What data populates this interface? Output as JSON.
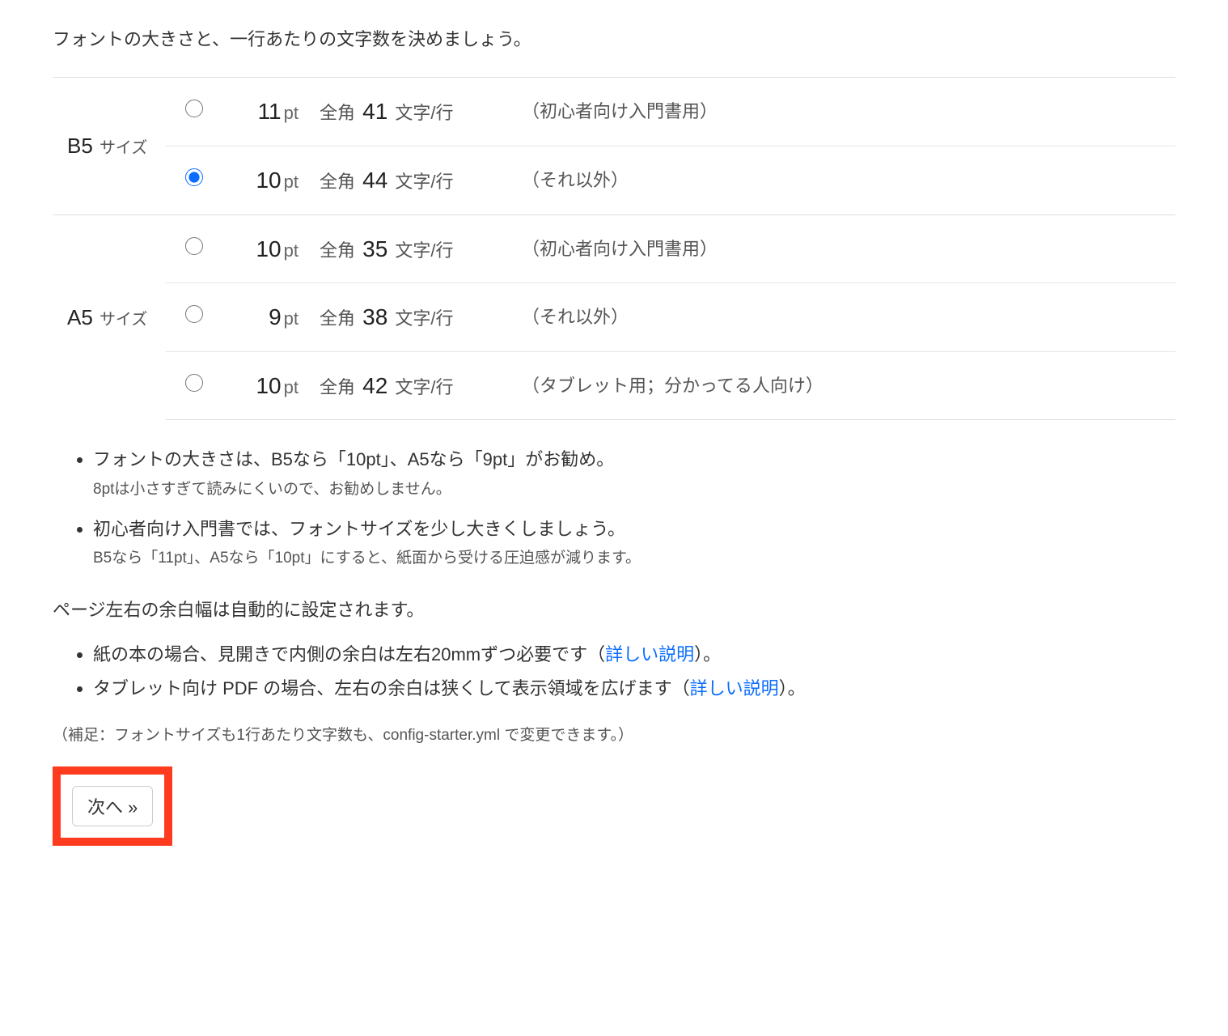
{
  "intro": "フォントの大きさと、一行あたりの文字数を決めましょう。",
  "sizes": {
    "b5": {
      "label_big": "B5",
      "label_suffix": "サイズ"
    },
    "a5": {
      "label_big": "A5",
      "label_suffix": "サイズ"
    }
  },
  "chars_prefix": "全角",
  "chars_suffix": "文字/行",
  "pt_unit": "pt",
  "rows": [
    {
      "id": "b5-11",
      "pt": "11",
      "chars": "41",
      "note": "（初心者向け入門書用）",
      "checked": false
    },
    {
      "id": "b5-10",
      "pt": "10",
      "chars": "44",
      "note": "（それ以外）",
      "checked": true
    },
    {
      "id": "a5-10",
      "pt": "10",
      "chars": "35",
      "note": "（初心者向け入門書用）",
      "checked": false
    },
    {
      "id": "a5-9",
      "pt": "9",
      "chars": "38",
      "note": "（それ以外）",
      "checked": false
    },
    {
      "id": "a5-10t",
      "pt": "10",
      "chars": "42",
      "note": "（タブレット用；分かってる人向け）",
      "checked": false
    }
  ],
  "tips": [
    {
      "main": "フォントの大きさは、B5なら「10pt」、A5なら「9pt」がお勧め。",
      "sub": "8ptは小さすぎて読みにくいので、お勧めしません。"
    },
    {
      "main": "初心者向け入門書では、フォントサイズを少し大きくしましょう。",
      "sub": "B5なら「11pt」、A5なら「10pt」にすると、紙面から受ける圧迫感が減ります。"
    }
  ],
  "margin_intro": "ページ左右の余白幅は自動的に設定されます。",
  "margin_list": [
    {
      "pre": "紙の本の場合、見開きで内側の余白は左右20mmずつ必要です（",
      "link": "詳しい説明",
      "post": "）。"
    },
    {
      "pre": "タブレット向け PDF の場合、左右の余白は狭くして表示領域を広げます（",
      "link": "詳しい説明",
      "post": "）。"
    }
  ],
  "footnote": "（補足：フォントサイズも1行あたり文字数も、config-starter.yml で変更できます。）",
  "next_button": "次へ »"
}
